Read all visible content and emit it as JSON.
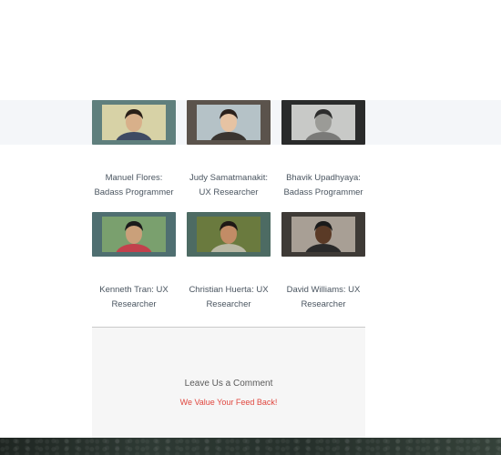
{
  "team": [
    {
      "name": "Manuel Flores:",
      "role": "Badass Programmer",
      "frame": "#5f7f7d",
      "bg": "#d7d2a6",
      "skin": "#d8b08a",
      "hair": "#2a2018",
      "shirt": "#3f4b63"
    },
    {
      "name": "Judy Samatmanakit:",
      "role": "UX Researcher",
      "frame": "#5b534c",
      "bg": "#b5c2c7",
      "skin": "#e6c3a3",
      "hair": "#2b211c",
      "shirt": "#3a3531"
    },
    {
      "name": "Bhavik Upadhyaya:",
      "role": "Badass Programmer",
      "frame": "#2a2b2b",
      "bg": "#c8c9c7",
      "skin": "#9b9b97",
      "hair": "#2d2d2d",
      "shirt": "#7a7a78"
    },
    {
      "name": "Kenneth Tran: UX",
      "role": "Researcher",
      "frame": "#4f6f71",
      "bg": "#7aa06e",
      "skin": "#caa07a",
      "hair": "#1b1b1b",
      "shirt": "#c2414c"
    },
    {
      "name": "Christian Huerta: UX",
      "role": "Researcher",
      "frame": "#4d6b63",
      "bg": "#6a7a3e",
      "skin": "#c28c66",
      "hair": "#1f1915",
      "shirt": "#b9b8a4"
    },
    {
      "name": "David Williams: UX",
      "role": "Researcher",
      "frame": "#3e3a36",
      "bg": "#a89f95",
      "skin": "#5a3a26",
      "hair": "#1a1a1a",
      "shirt": "#2a2a2a"
    }
  ],
  "comment": {
    "title": "Leave Us a Comment",
    "link": "We Value Your Feed Back!",
    "link_color": "#e0473f"
  }
}
